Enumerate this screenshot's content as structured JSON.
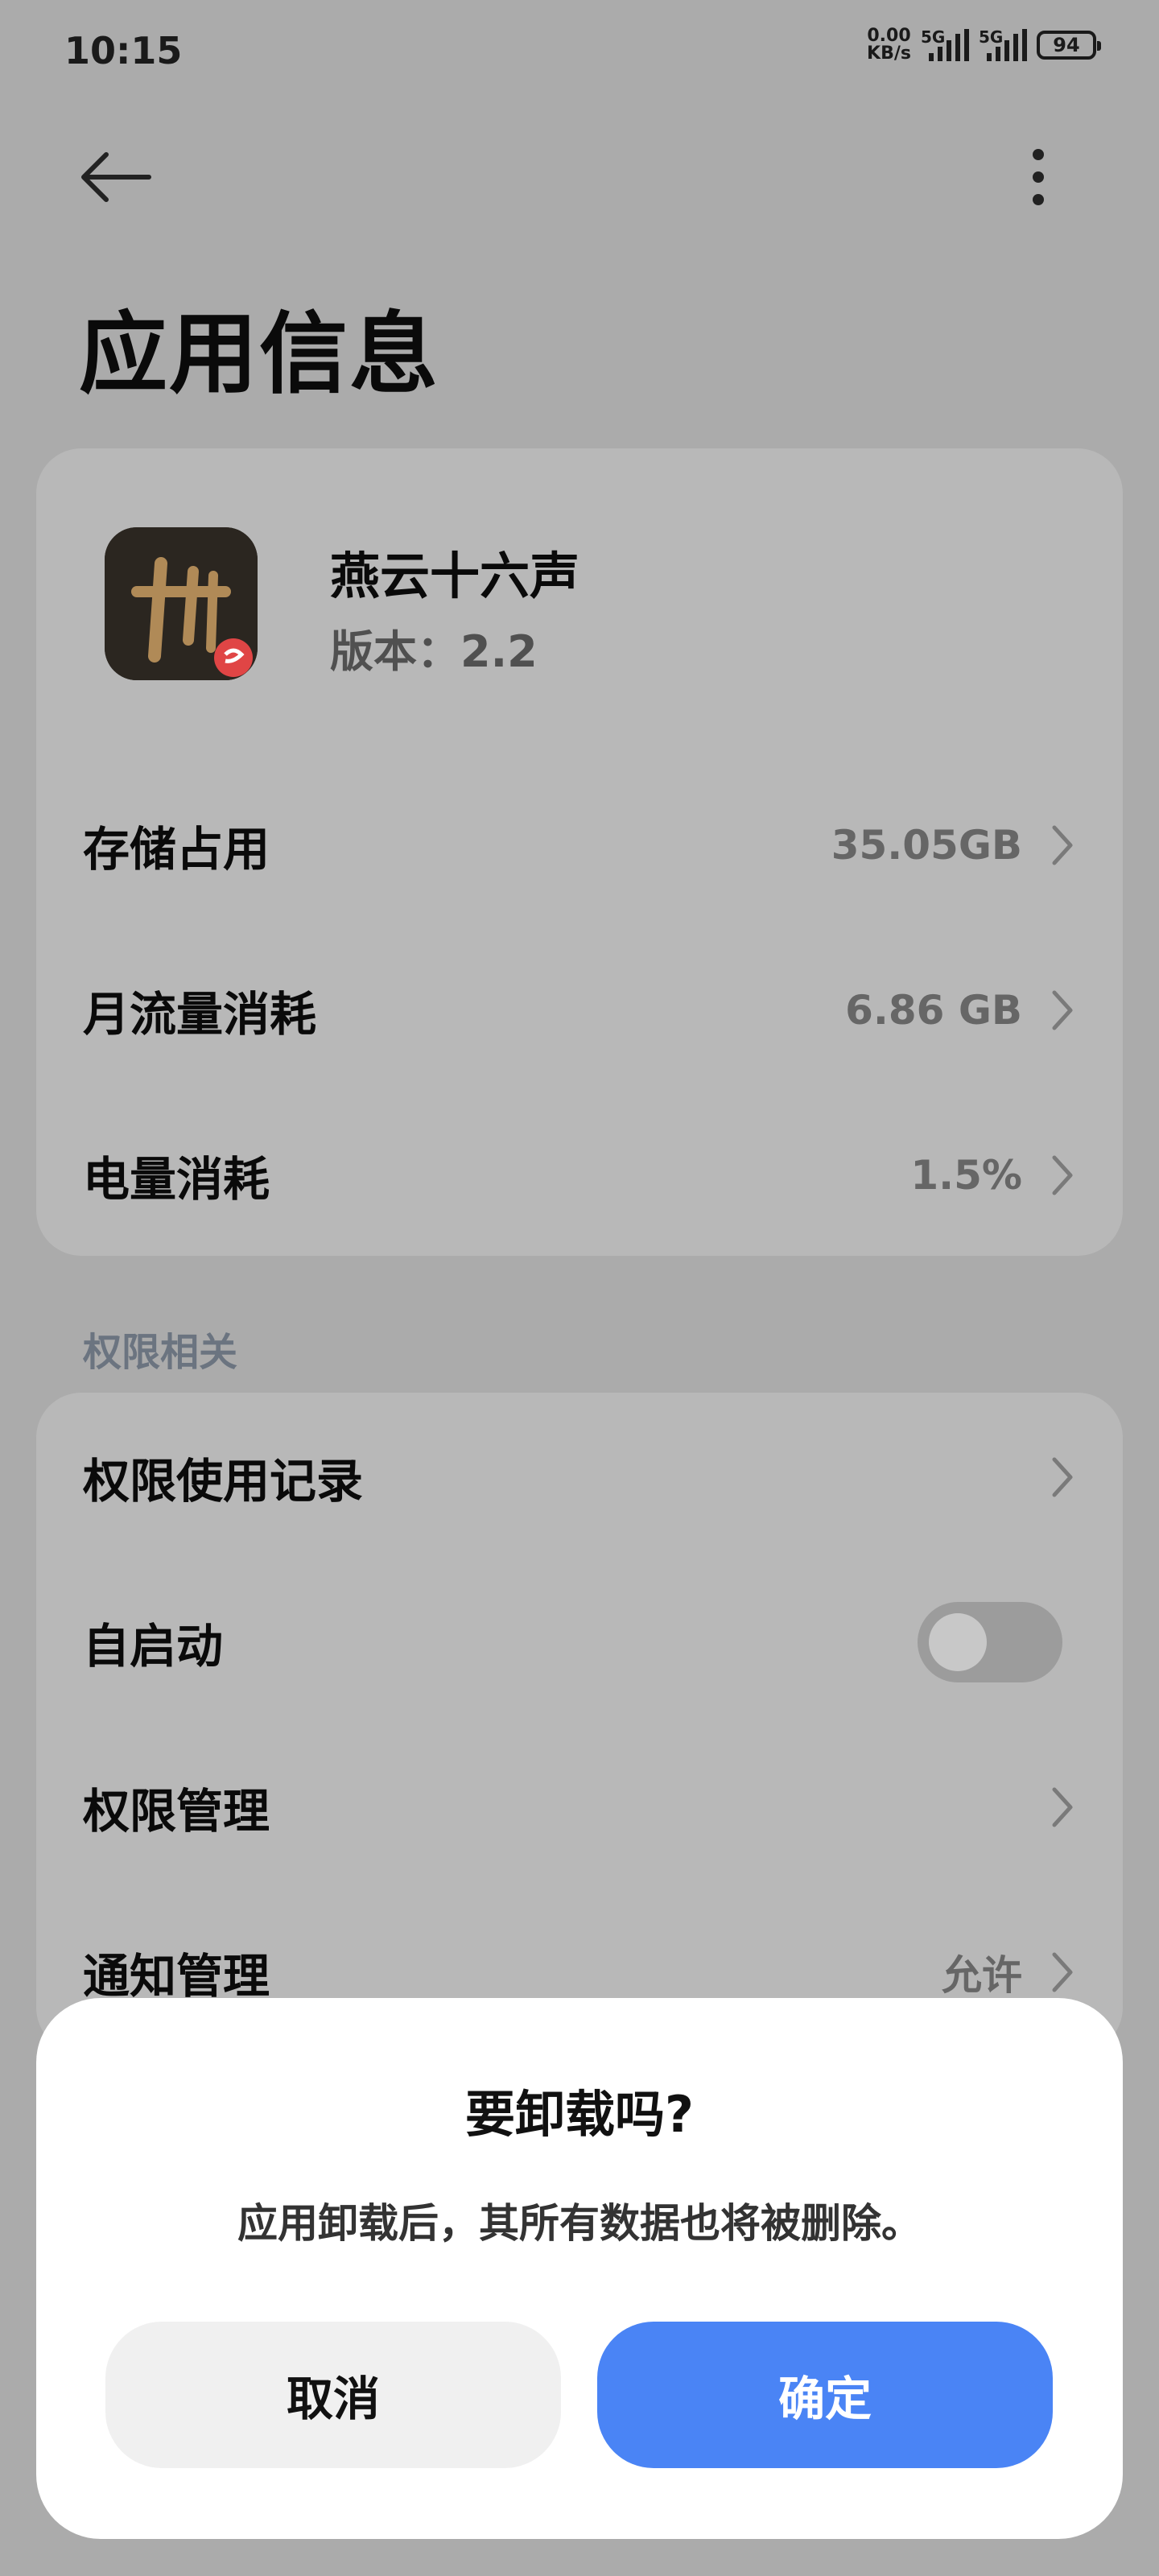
{
  "status_bar": {
    "time": "10:15",
    "net_speed_value": "0.00",
    "net_speed_unit": "KB/s",
    "sim1_label": "5G",
    "sim2_label": "5G",
    "battery": "94"
  },
  "page": {
    "title": "应用信息",
    "back_icon": "arrow-left-icon",
    "more_icon": "more-vertical-icon"
  },
  "app": {
    "name": "燕云十六声",
    "version": "版本：2.2"
  },
  "info_rows": [
    {
      "label": "存储占用",
      "value": "35.05GB"
    },
    {
      "label": "月流量消耗",
      "value": "6.86 GB"
    },
    {
      "label": "电量消耗",
      "value": "1.5%"
    }
  ],
  "permissions": {
    "section_label": "权限相关",
    "rows": [
      {
        "label": "权限使用记录",
        "value": ""
      },
      {
        "label": "自启动",
        "toggle_on": false
      },
      {
        "label": "权限管理",
        "value": ""
      },
      {
        "label": "通知管理",
        "value": "允许"
      }
    ]
  },
  "dialog": {
    "title": "要卸载吗?",
    "message": "应用卸载后，其所有数据也将被删除。",
    "cancel_label": "取消",
    "confirm_label": "确定"
  },
  "colors": {
    "background_dimmed": "#ababab",
    "card": "#b8b8b8",
    "accent": "#4a84f5",
    "cancel_button": "#f0f0f0"
  }
}
